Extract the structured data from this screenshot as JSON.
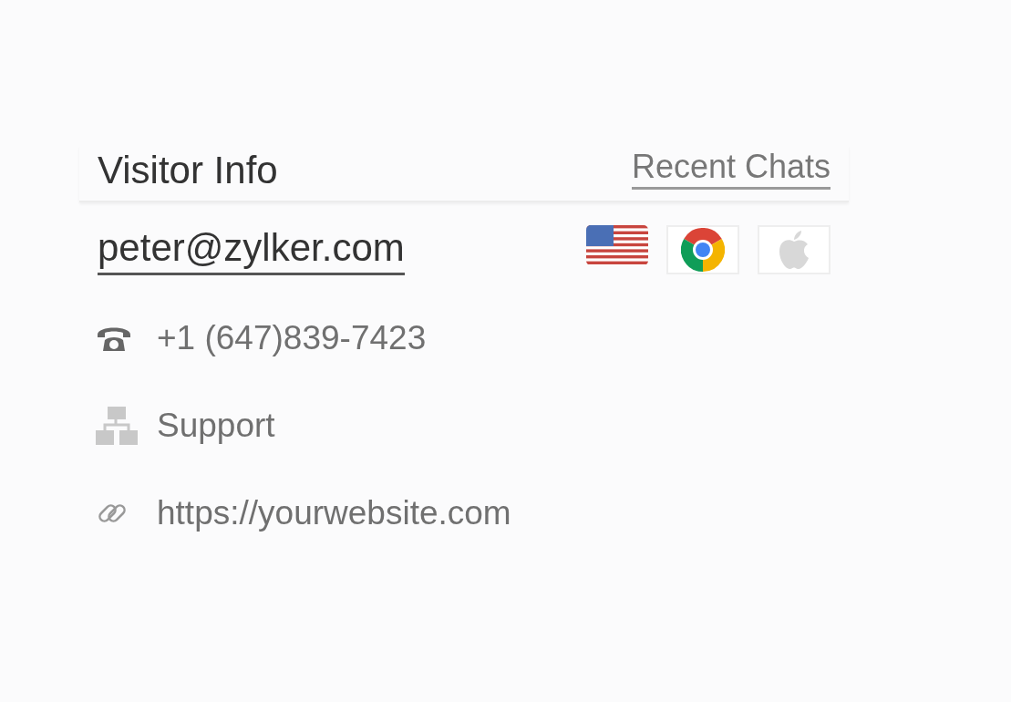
{
  "header": {
    "title": "Visitor Info",
    "tabs": [
      {
        "label": "Recent Chats",
        "selected": false
      }
    ]
  },
  "visitor": {
    "email": "peter@zylker.com",
    "badges": [
      {
        "kind": "flag"
      },
      {
        "kind": "browser"
      },
      {
        "kind": "os"
      }
    ]
  },
  "details": [
    {
      "kind": "phone",
      "text": "+1 (647)839-7423"
    },
    {
      "kind": "department",
      "text": "Support"
    },
    {
      "kind": "link",
      "text": "https://yourwebsite.com"
    }
  ]
}
